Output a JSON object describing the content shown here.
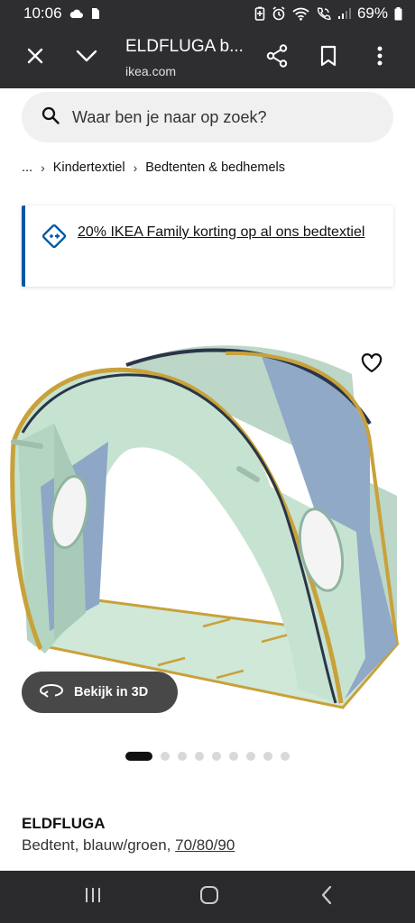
{
  "status_bar": {
    "time": "10:06",
    "battery": "69%",
    "icons": [
      "cloud-icon",
      "sim-card-icon",
      "battery-saver-icon",
      "alarm-icon",
      "wifi-icon",
      "wifi-call-icon",
      "signal-icon",
      "battery-icon"
    ]
  },
  "browser": {
    "title": "ELDFLUGA b...",
    "domain": "ikea.com",
    "buttons": [
      "close",
      "collapse",
      "share",
      "bookmark",
      "more"
    ]
  },
  "search": {
    "placeholder": "Waar ben je naar op zoek?"
  },
  "breadcrumb": {
    "ellipsis": "...",
    "items": [
      "Kindertextiel",
      "Bedtenten & bedhemels"
    ]
  },
  "promo": {
    "text": "20% IKEA Family korting op al ons bedtextiel"
  },
  "media": {
    "view_3d_label": "Bekijk in 3D",
    "image_count": 10,
    "active_index": 0
  },
  "product": {
    "name": "ELDFLUGA",
    "description": "Bedtent, blauw/groen, ",
    "size": "70/80/90"
  },
  "colors": {
    "system_bar": "#2e2e30",
    "ikea_blue": "#0058a3",
    "search_bg": "#f0f0f0",
    "tent_green": "#c6e3d2",
    "tent_blue": "#8aa6c6",
    "tent_trim": "#c9a13a"
  }
}
